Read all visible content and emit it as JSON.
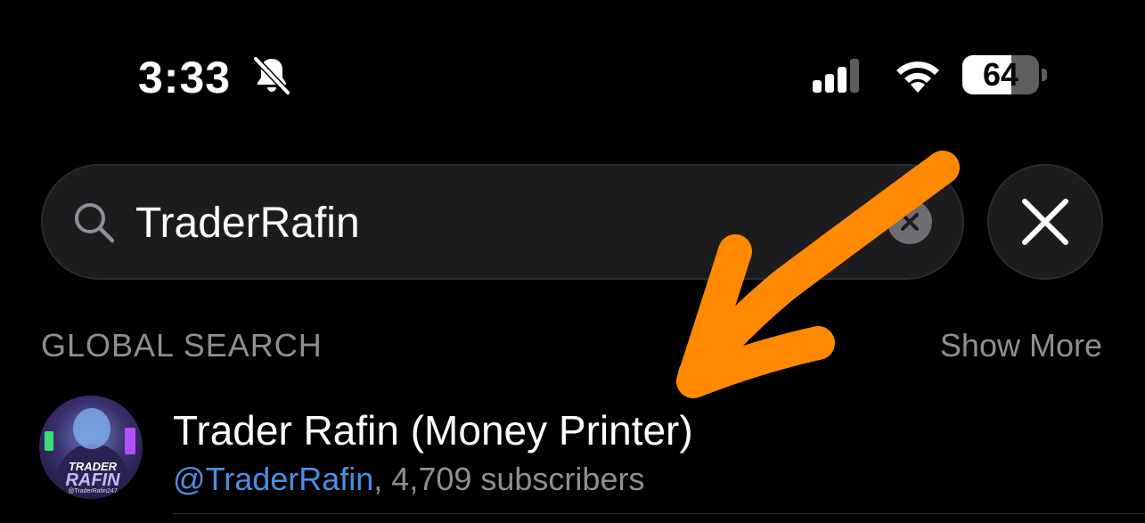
{
  "status_bar": {
    "time": "3:33",
    "battery": "64",
    "battery_level": 0.64,
    "icons": [
      "bell-slash-icon",
      "signal-icon",
      "wifi-icon",
      "battery-icon"
    ]
  },
  "search": {
    "value": "TraderRafin",
    "icon": "search-icon",
    "clear_icon": "clear-icon",
    "close_icon": "close-icon"
  },
  "section": {
    "title": "GLOBAL SEARCH",
    "show_more": "Show More"
  },
  "results": [
    {
      "title": "Trader Rafin (Money Printer)",
      "username": "@TraderRafin",
      "separator": ", ",
      "subscribers": "4,709 subscribers",
      "avatar": {
        "line1": "TRADER",
        "line2": "RAFIN",
        "line3": "@TraderRafin247"
      }
    }
  ],
  "colors": {
    "background": "#000000",
    "accent": "#4a90e2",
    "annotation_arrow": "#ff8a00",
    "secondary_text": "#8e8e93"
  }
}
